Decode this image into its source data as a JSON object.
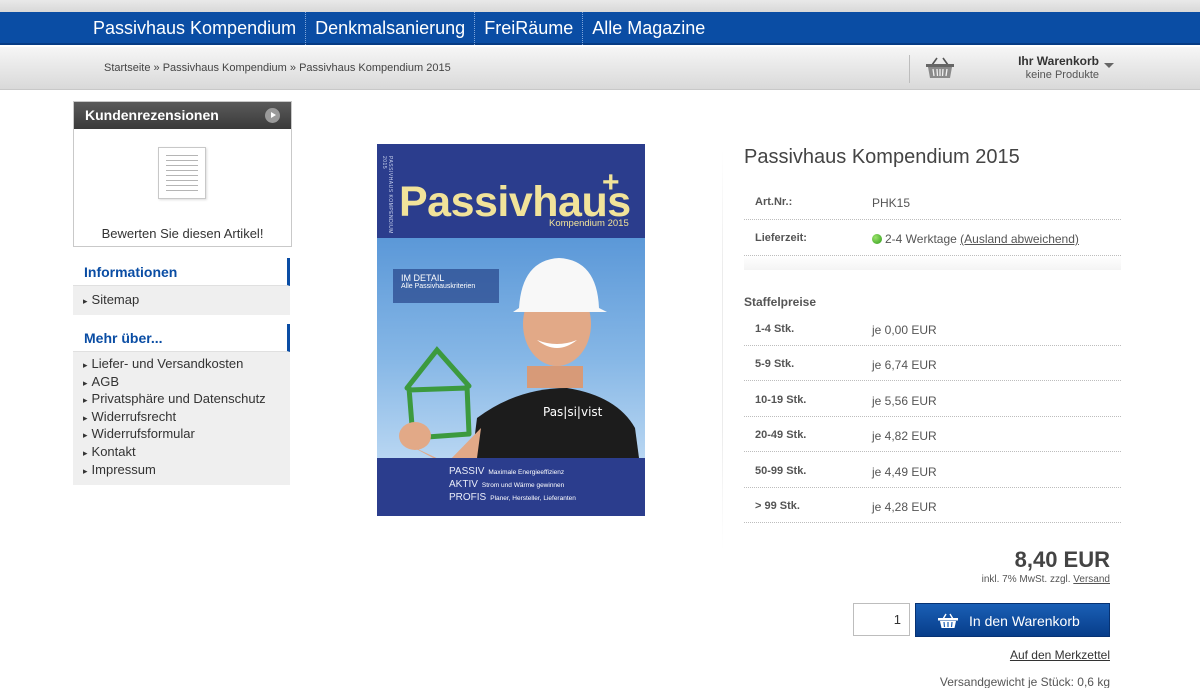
{
  "nav": {
    "items": [
      "Passivhaus Kompendium",
      "Denkmalsanierung",
      "FreiRäume",
      "Alle Magazine"
    ]
  },
  "breadcrumb": {
    "items": [
      "Startseite",
      "Passivhaus Kompendium",
      "Passivhaus Kompendium 2015"
    ],
    "separator": " » "
  },
  "cart": {
    "title": "Ihr Warenkorb",
    "subtitle": "keine Produkte",
    "icon": "basket-icon"
  },
  "sidebar": {
    "reviews": {
      "title": "Kundenrezensionen",
      "link": "Bewerten Sie diesen Artikel!"
    },
    "informationen": {
      "title": "Informationen",
      "items": [
        "Sitemap"
      ]
    },
    "mehr": {
      "title": "Mehr über...",
      "items": [
        "Liefer- und Versandkosten",
        "AGB",
        "Privatsphäre und Datenschutz",
        "Widerrufsrecht",
        "Widerrufsformular",
        "Kontakt",
        "Impressum"
      ]
    }
  },
  "cover": {
    "spine": "PASSIVHAUS KOMPENDIUM 2015",
    "title": "Passivhaus",
    "plus": "+",
    "subtitle": "Kompendium 2015",
    "detail_title": "IM DETAIL",
    "detail_sub": "Alle Passivhauskriterien",
    "lines": [
      {
        "key": "PASSIV",
        "text": "Maximale Energieeffizienz"
      },
      {
        "key": "AKTIV",
        "text": "Strom und Wärme gewinnen"
      },
      {
        "key": "PROFIS",
        "text": "Planer, Hersteller, Lieferanten"
      }
    ],
    "shirt_text": "Pas|si|vist"
  },
  "product": {
    "title": "Passivhaus Kompendium 2015",
    "art_label": "Art.Nr.:",
    "art_value": "PHK15",
    "liefer_label": "Lieferzeit:",
    "liefer_value": "2-4 Werktage",
    "liefer_link": "(Ausland abweichend)",
    "staffel_title": "Staffelpreise",
    "staffel": [
      {
        "qty": "1-4 Stk.",
        "price": "je 0,00 EUR"
      },
      {
        "qty": "5-9 Stk.",
        "price": "je 6,74 EUR"
      },
      {
        "qty": "10-19 Stk.",
        "price": "je 5,56 EUR"
      },
      {
        "qty": "20-49 Stk.",
        "price": "je 4,82 EUR"
      },
      {
        "qty": "50-99 Stk.",
        "price": "je 4,49 EUR"
      },
      {
        "qty": "> 99 Stk.",
        "price": "je 4,28 EUR"
      }
    ],
    "price": "8,40 EUR",
    "vat_text": "inkl. 7% MwSt. zzgl.",
    "vat_link": "Versand",
    "quantity": "1",
    "add_to_cart": "In den Warenkorb",
    "wishlist": "Auf den Merkzettel",
    "weight": "Versandgewicht je Stück: 0,6 kg"
  },
  "colors": {
    "nav_blue": "#0a4da4",
    "cover_blue": "#2b3d8d",
    "cover_yellow": "#f1e39a",
    "green": "#2e9b19"
  }
}
